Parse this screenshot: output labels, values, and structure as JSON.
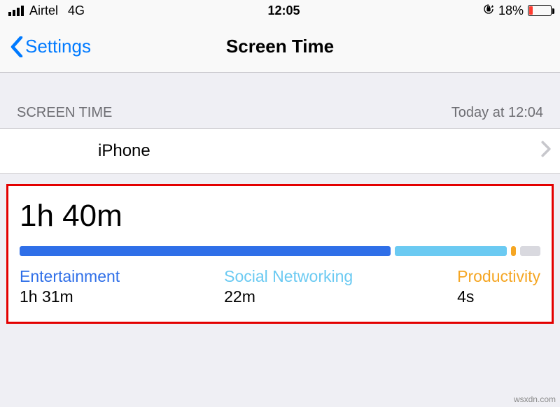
{
  "status": {
    "carrier": "Airtel",
    "network": "4G",
    "time": "12:05",
    "battery_pct": "18%",
    "battery_fill_pct": 18
  },
  "nav": {
    "back_label": "Settings",
    "title": "Screen Time"
  },
  "section": {
    "header": "SCREEN TIME",
    "timestamp": "Today at 12:04"
  },
  "device": {
    "name": "iPhone"
  },
  "summary": {
    "total": "1h 40m",
    "categories": {
      "entertainment": {
        "label": "Entertainment",
        "value": "1h 31m"
      },
      "social": {
        "label": "Social Networking",
        "value": "22m"
      },
      "productivity": {
        "label": "Productivity",
        "value": "4s"
      }
    }
  },
  "chart_data": {
    "type": "bar",
    "title": "Screen Time breakdown",
    "total_seconds": 6000,
    "categories": [
      "Entertainment",
      "Social Networking",
      "Productivity"
    ],
    "values_seconds": [
      5460,
      1320,
      4
    ],
    "display_values": [
      "1h 31m",
      "22m",
      "4s"
    ],
    "colors": [
      "#2f6fe8",
      "#6bcaf2",
      "#f5a623"
    ],
    "bar_fractions": [
      0.73,
      0.22,
      0.01,
      0.04
    ]
  },
  "watermark": "wsxdn.com"
}
